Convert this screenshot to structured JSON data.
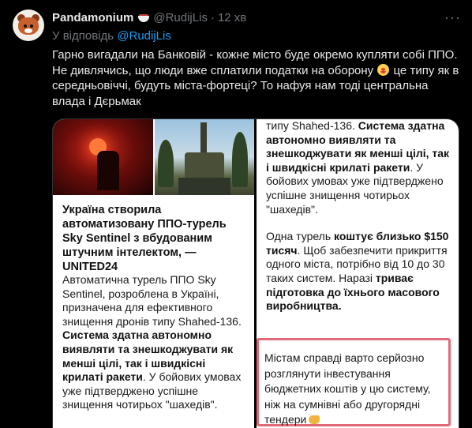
{
  "author": {
    "name": "Pandamonium",
    "badge_icon": "food-bowl-emoji",
    "handle": "@RudijLis",
    "separator": "·",
    "time": "12 хв"
  },
  "more_icon": "···",
  "reply": {
    "prefix": "У відповідь",
    "to": "@RudijLis"
  },
  "tweet_text": {
    "part1": "Гарно вигадали на Банковій - кожне місто буде окремо купляти собі ППО. Не дивлячись, що люди вже сплатили податки на оборону ",
    "emoji": "clown-face",
    "part2": " це типу як в середньовіччі, будуть міста-фортеці? То нафуя нам тоді центральна влада і Дєрьмак"
  },
  "card_left": {
    "title": "Україна створила автоматизовану ППО-турель Sky Sentinel з вбудованим штучним інтелектом, — UNITED24",
    "body_plain": "Автоматична турель ППО Sky Sentinel, розроблена в Україні, призначена для ефективного знищення дронів типу Shahed-136. ",
    "body_bold1": "Система здатна автономно виявляти та знешкоджувати як менші цілі, так і швидкісні крилаті ракети",
    "body_plain2": ". У бойових умовах уже підтверджено успішне знищення чотирьох \"шахедів\"."
  },
  "card_right": {
    "p1_plain": "типу Shahed-136. ",
    "p1_bold": "Система здатна автономно виявляти та знешкоджувати як менші цілі, так і швидкісні крилаті ракети",
    "p1_plain2": ". У бойових умовах уже підтверджено успішне знищення чотирьох \"шахедів\".",
    "p2_plain1": "Одна турель ",
    "p2_bold1": "коштує близько $150 тисяч",
    "p2_plain2": ". Щоб забезпечити прикриття одного міста, потрібно від 10 до 30 таких систем. Наразі ",
    "p2_bold2": "триває підготовка до їхнього масового виробництва.",
    "highlight_text": "Містам справді варто серйозно розглянути інвестування бюджетних коштів у цю систему, ніж на сумнівні або другорядні тендери",
    "highlight_emoji": "pointing-hand"
  },
  "colors": {
    "link": "#1d9bf0",
    "muted": "#71767b",
    "highlight_border": "#e06a78"
  }
}
